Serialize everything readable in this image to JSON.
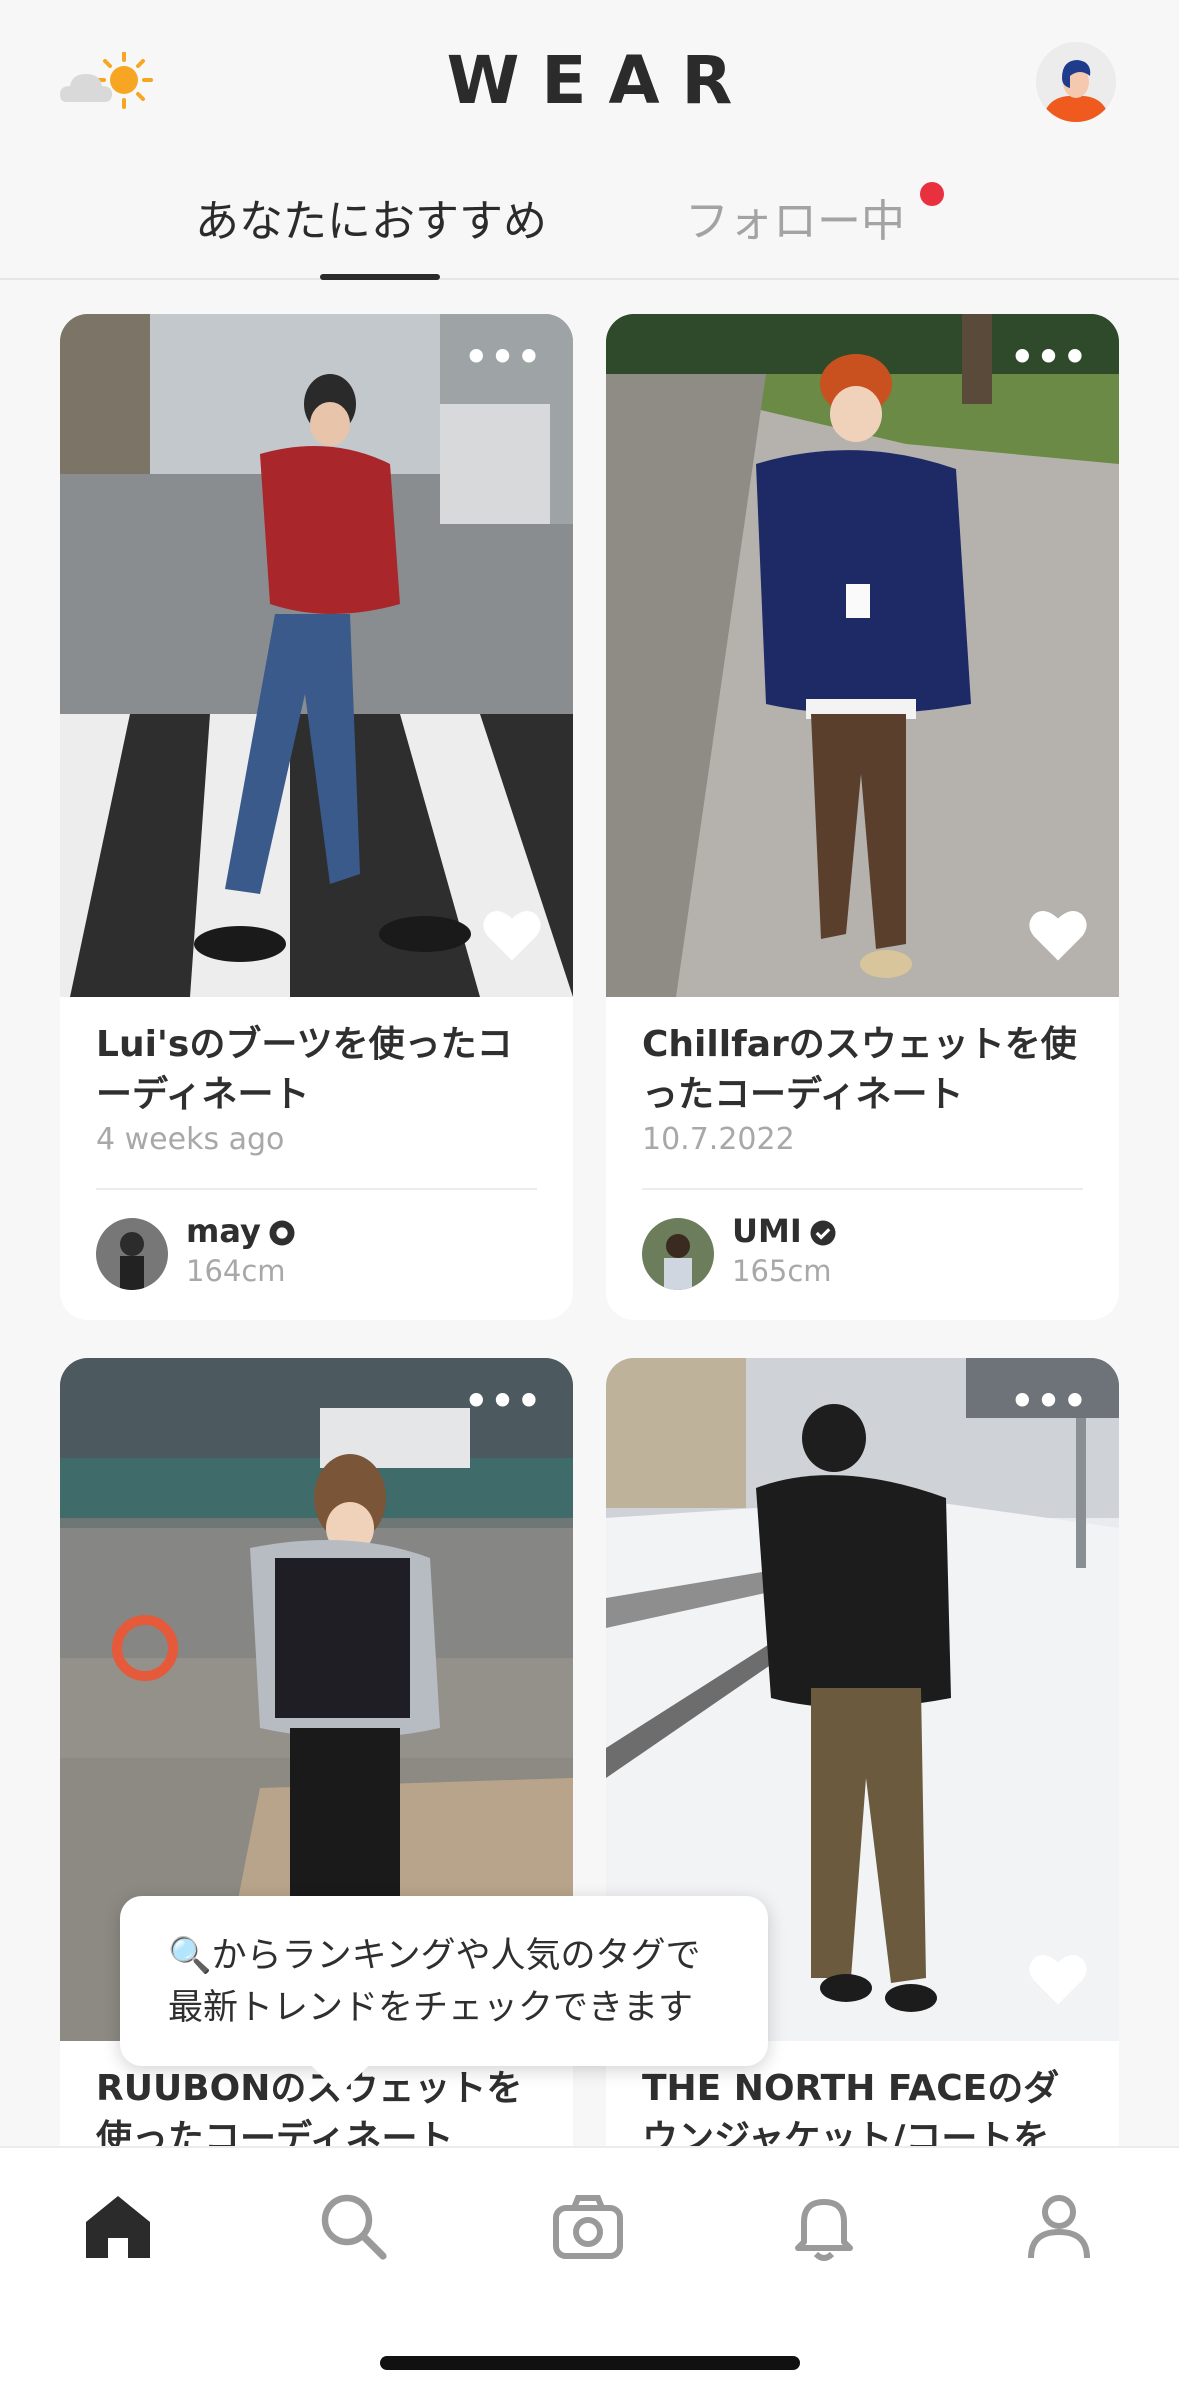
{
  "header": {
    "logo": "WEAR",
    "weather_icon": "partly-sunny-icon",
    "tabs": [
      {
        "label": "あなたにおすすめ",
        "active": true
      },
      {
        "label": "フォロー中",
        "active": false,
        "has_notification": true
      }
    ]
  },
  "cards": [
    {
      "title": "Lui'sのブーツを使ったコーディネート",
      "date": "4 weeks ago",
      "user": "may",
      "height": "164cm",
      "badge": "shop-badge-icon"
    },
    {
      "title": "Chillfarのスウェットを使ったコーディネート",
      "date": "10.7.2022",
      "user": "UMI",
      "height": "165cm",
      "badge": "verified-badge-icon"
    },
    {
      "title": "RUUBONのスウェットを使ったコーディネート"
    },
    {
      "title": "THE NORTH FACEのダウンジャケット/コートを"
    }
  ],
  "tooltip": {
    "icon": "🔍",
    "line1": "からランキングや人気のタグで",
    "line2": "最新トレンドをチェックできます"
  },
  "nav": [
    "home-icon",
    "search-icon",
    "camera-icon",
    "bell-icon",
    "profile-icon"
  ],
  "colors": {
    "accent": "#2b2b2b",
    "notification": "#e8303f",
    "muted": "#a8a8a8"
  }
}
